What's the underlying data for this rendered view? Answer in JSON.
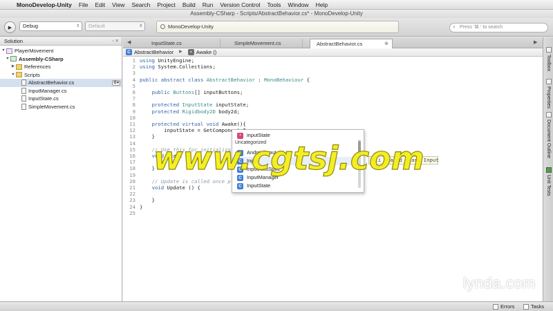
{
  "menubar": {
    "app": "MonoDevelop-Unity",
    "items": [
      "File",
      "Edit",
      "View",
      "Search",
      "Project",
      "Build",
      "Run",
      "Version Control",
      "Tools",
      "Window",
      "Help"
    ]
  },
  "window": {
    "title": "Assembly-CSharp - Scripts/AbstractBehavior.cs* - MonoDevelop-Unity"
  },
  "toolbar": {
    "config": "Debug",
    "platform": "Default",
    "status": "MonoDevelop-Unity",
    "search_placeholder": "Press '⌘.' to search"
  },
  "solution": {
    "title": "Solution",
    "items": [
      {
        "label": "PlayerMovement"
      },
      {
        "label": "Assembly-CSharp"
      },
      {
        "label": "References"
      },
      {
        "label": "Scripts"
      },
      {
        "label": "AbstractBehavior.cs"
      },
      {
        "label": "InputManager.cs"
      },
      {
        "label": "InputState.cs"
      },
      {
        "label": "SimpleMovement.cs"
      }
    ]
  },
  "tabs": [
    {
      "label": "InputState.cs"
    },
    {
      "label": "SimpleMovement.cs"
    },
    {
      "label": "AbstractBehavior.cs"
    }
  ],
  "path": {
    "class": "AbstractBehavior",
    "member": "Awake ()"
  },
  "code": {
    "lines": [
      "1",
      "2",
      "3",
      "4",
      "5",
      "6",
      "7",
      "8",
      "9",
      "10",
      "11",
      "12",
      "13",
      "14",
      "15",
      "16",
      "17",
      "18",
      "19",
      "20",
      "21",
      "22",
      "23",
      "24",
      "25"
    ],
    "l1a": "using",
    "l1b": " UnityEngine;",
    "l2a": "using",
    "l2b": " System.Collections;",
    "l4a": "public abstract class",
    "l4b": " AbstractBehavior",
    "l4c": " : ",
    "l4d": "MonoBehaviour",
    "l4e": " {",
    "l6a": "public",
    "l6b": " Buttons",
    "l6c": "[] inputButtons;",
    "l8a": "protected",
    "l8b": " InputState",
    "l8c": " inputState;",
    "l9a": "protected",
    "l9b": " Rigidbody2D",
    "l9c": " body2d;",
    "l11a": "protected virtual void",
    "l11b": " Awake(){",
    "l12": "inputState = GetComponent<Inpu",
    "l13": "}",
    "l15": "// Use this for initializa",
    "l16a": "void",
    "l16b": " Start () {",
    "l18": "}",
    "l20": "// Update is called once p",
    "l21a": "void",
    "l21b": " Update () {",
    "l23": "}",
    "l24": "}"
  },
  "completion": {
    "top_item": "inputState",
    "group": "Uncategorized",
    "items": [
      "AndroidInput",
      "Input",
      "InputAxisState",
      "InputManager",
      "InputState"
    ],
    "tooltip": "ali Sealed class Input"
  },
  "watermark": "www.cgtsj.com",
  "right_pads": [
    "Toolbox",
    "Properties",
    "Document Outline",
    "Unit Tests"
  ],
  "statusbar": {
    "errors": "Errors",
    "tasks": "Tasks"
  },
  "brand": "lynda.com"
}
